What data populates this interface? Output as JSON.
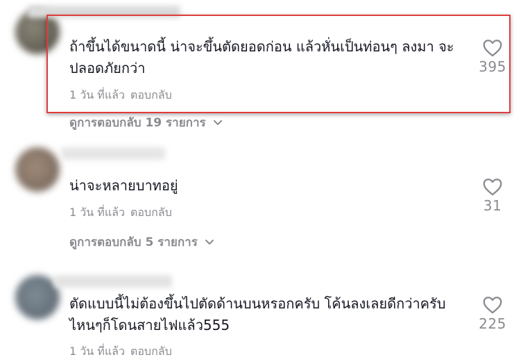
{
  "accent_highlight_color": "#e03c3c",
  "comments": [
    {
      "text": "ถ้าขึ้นได้ขนาดนี้ น่าจะขึ้นตัดยอดก่อน แล้วหั่นเป็นท่อนๆ ลงมา จะปลอดภัยกว่า",
      "time": "1 วัน ที่แล้ว",
      "reply_label": "ตอบกลับ",
      "likes": "395",
      "view_replies": "ดูการตอบกลับ 19 รายการ",
      "highlighted": true
    },
    {
      "text": "น่าจะหลายบาทอยู่",
      "time": "1 วัน ที่แล้ว",
      "reply_label": "ตอบกลับ",
      "likes": "31",
      "view_replies": "ดูการตอบกลับ 5 รายการ"
    },
    {
      "text": "ตัดแบบนี้ไม่ต้องขึ้นไปตัดด้านบนหรอกครับ โค้นลงเลยดีกว่าครับ ไหนๆก็โดนสายไฟแล้ว555",
      "time": "1 วัน ที่แล้ว",
      "reply_label": "ตอบกลับ",
      "likes": "225"
    }
  ],
  "icons": {
    "like": "heart-outline-icon",
    "expand": "chevron-down-icon"
  }
}
